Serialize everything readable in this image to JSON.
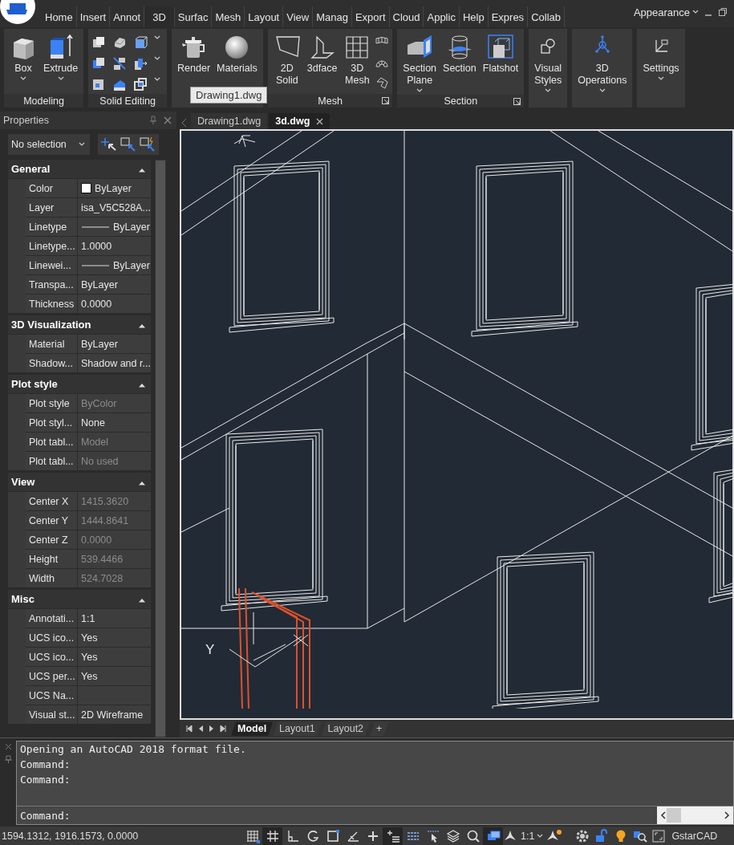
{
  "title_bar": {
    "workspace": "Appearance"
  },
  "menu_tabs": [
    {
      "label": "Home",
      "selected": false
    },
    {
      "label": "Insert",
      "selected": false
    },
    {
      "label": "Annot",
      "selected": false
    },
    {
      "label": "3D",
      "selected": true
    },
    {
      "label": "Surfac",
      "selected": false
    },
    {
      "label": "Mesh",
      "selected": false
    },
    {
      "label": "Layout",
      "selected": false
    },
    {
      "label": "View",
      "selected": false
    },
    {
      "label": "Manag",
      "selected": false
    },
    {
      "label": "Export",
      "selected": false
    },
    {
      "label": "Cloud",
      "selected": false
    },
    {
      "label": "Applic",
      "selected": false
    },
    {
      "label": "Help",
      "selected": false
    },
    {
      "label": "Expres",
      "selected": false
    },
    {
      "label": "Collab",
      "selected": false
    }
  ],
  "ribbon": {
    "panels": [
      {
        "kind": "plain",
        "label": "Modeling",
        "buttons": [
          {
            "label": "Box",
            "dropdown": true
          },
          {
            "label": "Extrude",
            "dropdown": true
          }
        ]
      },
      {
        "kind": "grid",
        "label": "Solid Editing"
      },
      {
        "kind": "plain",
        "buttons": [
          {
            "label": "Render"
          },
          {
            "label": "Materials"
          }
        ]
      },
      {
        "kind": "column",
        "label": "Mesh",
        "launcher": true,
        "buttons": [
          {
            "label": "2D Solid"
          },
          {
            "label": "3dface"
          },
          {
            "label": "3D Mesh"
          }
        ]
      },
      {
        "kind": "plain",
        "label": "Section",
        "launcher": true,
        "buttons": [
          {
            "label": "Section Plane",
            "dropdown": true
          },
          {
            "label": "Section"
          },
          {
            "label": "Flatshot"
          }
        ]
      },
      {
        "kind": "plain",
        "buttons": [
          {
            "label": "Visual Styles",
            "dropdown": true
          }
        ]
      },
      {
        "kind": "plain",
        "buttons": [
          {
            "label": "3D Operations",
            "dropdown": true
          }
        ]
      },
      {
        "kind": "plain",
        "buttons": [
          {
            "label": "Settings",
            "dropdown": true
          }
        ]
      }
    ],
    "tooltip": "Drawing1.dwg"
  },
  "properties": {
    "title": "Properties",
    "selector": "No selection",
    "sections": [
      {
        "title": "General",
        "expanded": true,
        "rows": [
          {
            "label": "Color",
            "value": "ByLayer",
            "kind": "swatch",
            "color": "#ffffff",
            "disabled": false
          },
          {
            "label": "Layer",
            "value": "isa_V5C528A...",
            "kind": "text",
            "disabled": false
          },
          {
            "label": "Linetype",
            "value": "ByLayer",
            "kind": "line",
            "disabled": false
          },
          {
            "label": "Linetype...",
            "value": "1.0000",
            "kind": "text",
            "disabled": false
          },
          {
            "label": "Linewei...",
            "value": "ByLayer",
            "kind": "line",
            "disabled": false
          },
          {
            "label": "Transpa...",
            "value": "ByLayer",
            "kind": "text",
            "disabled": false
          },
          {
            "label": "Thickness",
            "value": "0.0000",
            "kind": "text",
            "disabled": false
          }
        ]
      },
      {
        "title": "3D Visualization",
        "expanded": true,
        "rows": [
          {
            "label": "Material",
            "value": "ByLayer",
            "kind": "text",
            "disabled": false
          },
          {
            "label": "Shadow...",
            "value": "Shadow and r...",
            "kind": "text",
            "disabled": false
          }
        ]
      },
      {
        "title": "Plot style",
        "expanded": true,
        "rows": [
          {
            "label": "Plot style",
            "value": "ByColor",
            "kind": "text",
            "disabled": true
          },
          {
            "label": "Plot styl...",
            "value": "None",
            "kind": "text",
            "disabled": false
          },
          {
            "label": "Plot tabl...",
            "value": "Model",
            "kind": "text",
            "disabled": true
          },
          {
            "label": "Plot tabl...",
            "value": "No used",
            "kind": "text",
            "disabled": true
          }
        ]
      },
      {
        "title": "View",
        "expanded": true,
        "rows": [
          {
            "label": "Center X",
            "value": "1415.3620",
            "kind": "text",
            "disabled": true
          },
          {
            "label": "Center Y",
            "value": "1444.8641",
            "kind": "text",
            "disabled": true
          },
          {
            "label": "Center Z",
            "value": "0.0000",
            "kind": "text",
            "disabled": true
          },
          {
            "label": "Height",
            "value": "539.4466",
            "kind": "text",
            "disabled": true
          },
          {
            "label": "Width",
            "value": "524.7028",
            "kind": "text",
            "disabled": true
          }
        ]
      },
      {
        "title": "Misc",
        "expanded": true,
        "rows": [
          {
            "label": "Annotati...",
            "value": "1:1",
            "kind": "text",
            "disabled": false
          },
          {
            "label": "UCS ico...",
            "value": "Yes",
            "kind": "text",
            "disabled": false
          },
          {
            "label": "UCS ico...",
            "value": "Yes",
            "kind": "text",
            "disabled": false
          },
          {
            "label": "UCS per...",
            "value": "Yes",
            "kind": "text",
            "disabled": false
          },
          {
            "label": "UCS Na...",
            "kind": "text"
          },
          {
            "label": "Visual st...",
            "value": "2D Wireframe",
            "kind": "text",
            "disabled": false
          }
        ]
      }
    ]
  },
  "doc_tabs": [
    {
      "label": "Drawing1.dwg",
      "selected": false
    },
    {
      "label": "3d.dwg",
      "selected": true
    }
  ],
  "viewport": {
    "ucs_label": "Y"
  },
  "layout_tabs": [
    {
      "label": "Model",
      "selected": true
    },
    {
      "label": "Layout1",
      "selected": false
    },
    {
      "label": "Layout2",
      "selected": false
    },
    {
      "label": "+",
      "selected": false
    }
  ],
  "command": {
    "history": [
      "Opening an AutoCAD 2018 format file.",
      "Command:",
      "Command:"
    ],
    "prompt": "Command:"
  },
  "status_bar": {
    "coordinates": "1594.1312, 1916.1573, 0.0000",
    "toggles": [
      {
        "on": false
      },
      {
        "on": true
      },
      {
        "on": false
      },
      {
        "on": false
      },
      {
        "on": false
      },
      {
        "on": false
      },
      {
        "on": false
      },
      {
        "on": true
      },
      {
        "on": false
      },
      {
        "on": false
      },
      {
        "on": false
      },
      {
        "on": false
      },
      {
        "on": true
      }
    ],
    "scale": "1:1",
    "brand": "GstarCAD"
  }
}
